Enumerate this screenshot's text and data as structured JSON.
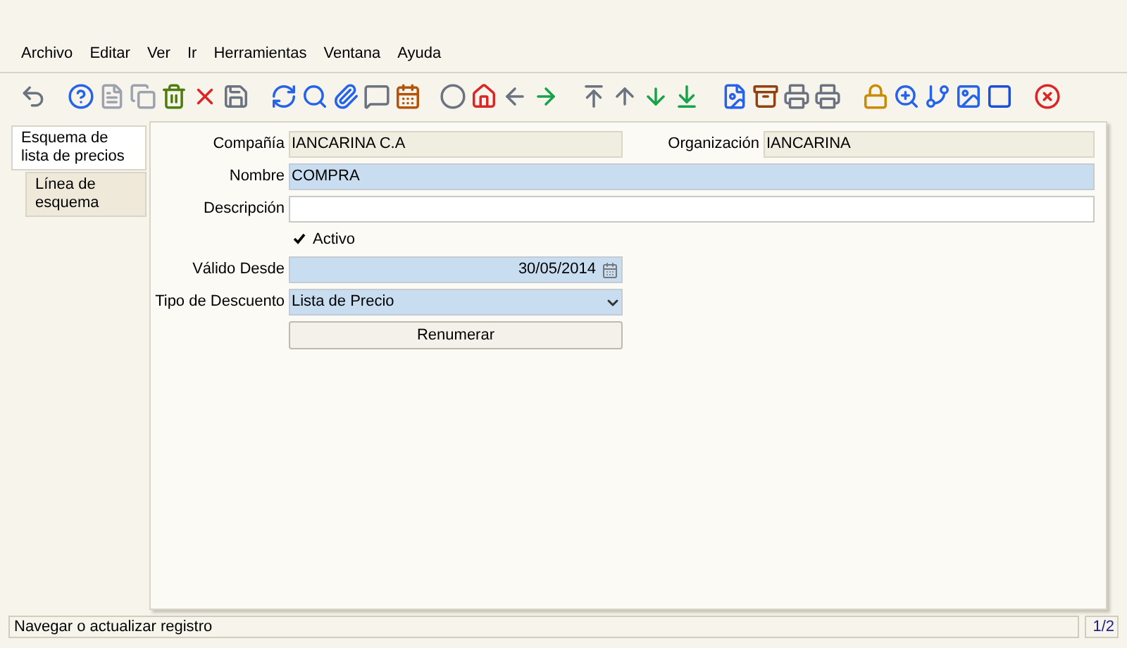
{
  "menu": [
    "Archivo",
    "Editar",
    "Ver",
    "Ir",
    "Herramientas",
    "Ventana",
    "Ayuda"
  ],
  "tabs": [
    {
      "label": "Esquema de lista de precios",
      "selected": true
    },
    {
      "label": "Línea de esquema",
      "selected": false
    }
  ],
  "form": {
    "company": {
      "label": "Compañía",
      "value": "IANCARINA C.A"
    },
    "organization": {
      "label": "Organización",
      "value": "IANCARINA"
    },
    "name": {
      "label": "Nombre",
      "value": "COMPRA"
    },
    "description": {
      "label": "Descripción"
    },
    "active": {
      "label": "Activo",
      "checked": true
    },
    "valid_from": {
      "label": "Válido Desde",
      "value": "30/05/2014"
    },
    "discount_type": {
      "label": "Tipo de Descuento",
      "value": "Lista de Precio"
    },
    "button": "Renumerar"
  },
  "status_bar": {
    "message": "Navegar o actualizar registro",
    "record": "1/2"
  }
}
